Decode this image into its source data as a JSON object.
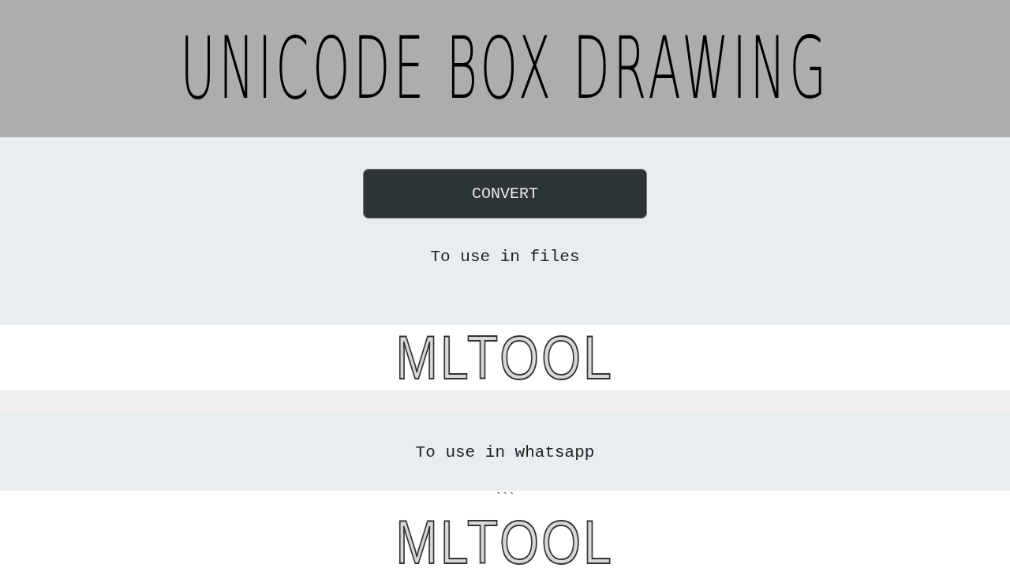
{
  "header": {
    "title": "UNICODE BOX DRAWING"
  },
  "convert_button": "CONVERT",
  "sections": [
    {
      "label": "To use in files",
      "art": "MLTOOL"
    },
    {
      "label": "To use in whatsapp",
      "prefix": "```",
      "art": "MLTOOL"
    }
  ]
}
